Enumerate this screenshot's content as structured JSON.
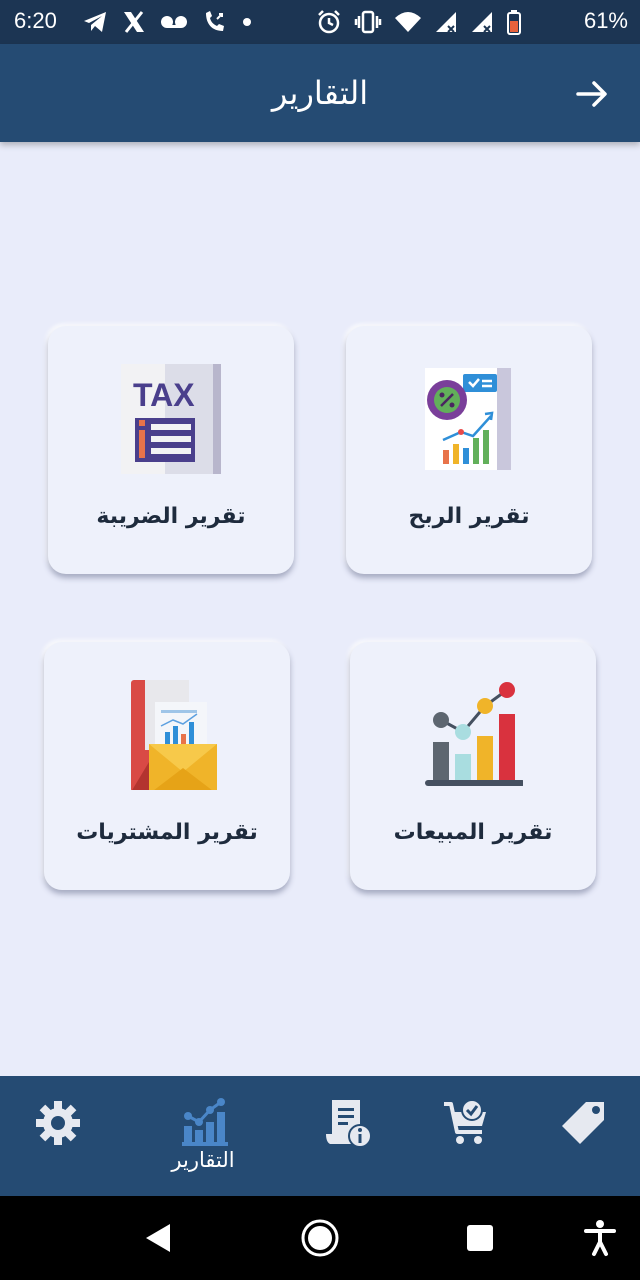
{
  "status_bar": {
    "time": "6:20",
    "battery": "61%",
    "left_icons": [
      "telegram-icon",
      "x-icon",
      "voicemail-icon",
      "wifi-call-icon",
      "dot-icon"
    ],
    "right_icons": [
      "alarm-icon",
      "vibrate-icon",
      "wifi-icon",
      "signal-icon",
      "signal-icon",
      "battery-icon"
    ]
  },
  "app_bar": {
    "title": "التقارير",
    "back_icon": "arrow-right-icon"
  },
  "cards": {
    "tax": {
      "label": "تقرير الضريبة",
      "icon_text": "TAX",
      "icon": "tax-report-icon"
    },
    "profit": {
      "label": "تقرير الربح",
      "icon": "profit-report-icon"
    },
    "purchases": {
      "label": "تقرير المشتريات",
      "icon": "purchases-report-icon"
    },
    "sales": {
      "label": "تقرير المبيعات",
      "icon": "sales-report-icon"
    }
  },
  "bottom_nav": {
    "reports_label": "التقارير",
    "items": [
      "settings-icon",
      "reports-icon",
      "invoice-info-icon",
      "cart-check-icon",
      "tag-icon"
    ]
  },
  "colors": {
    "status_bar": "#1c3553",
    "app_bar": "#254b73",
    "background": "#e9ecfa",
    "card": "#eef1fb",
    "active_nav": "#4a86c8"
  }
}
